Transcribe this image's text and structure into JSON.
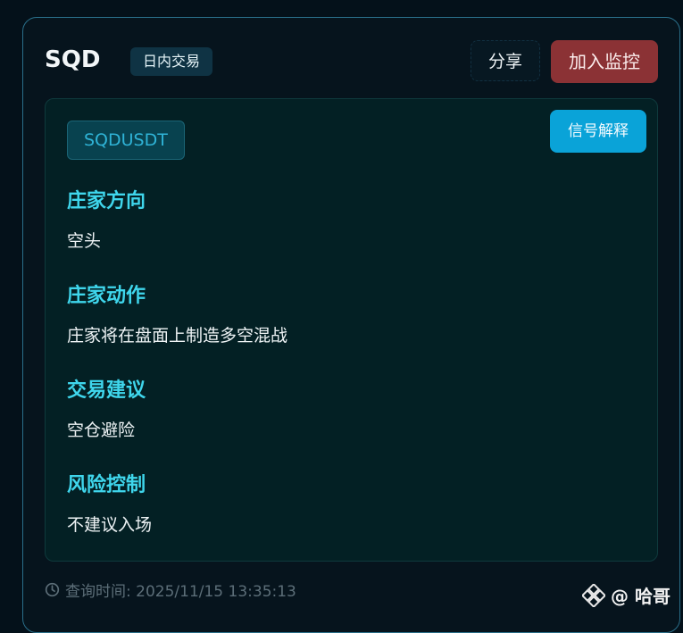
{
  "header": {
    "symbol": "SQD",
    "mode_badge": "日内交易",
    "share_label": "分享",
    "monitor_label": "加入监控"
  },
  "panel": {
    "pair": "SQDUSDT",
    "explain_label": "信号解释",
    "sections": [
      {
        "title": "庄家方向",
        "value": "空头"
      },
      {
        "title": "庄家动作",
        "value": "庄家将在盘面上制造多空混战"
      },
      {
        "title": "交易建议",
        "value": "空仓避险"
      },
      {
        "title": "风险控制",
        "value": "不建议入场"
      }
    ]
  },
  "footer": {
    "query_time": "查询时间: 2025/11/15 13:35:13"
  },
  "watermark": {
    "text": "@ 哈哥"
  },
  "icons": [
    "clock-icon",
    "binance-logo-icon"
  ],
  "colors": {
    "accent_cyan": "#3fd6ec",
    "monitor_red": "#8b3235",
    "explain_blue": "#0aa3d8"
  }
}
